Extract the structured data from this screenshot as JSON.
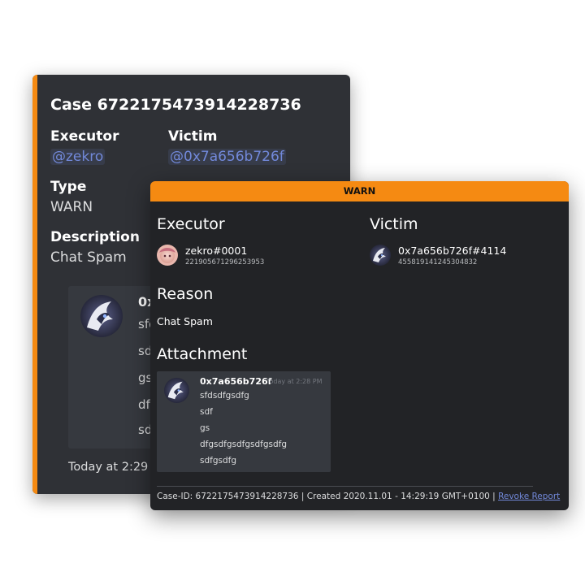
{
  "embed": {
    "title": "Case 6722175473914228736",
    "executor": {
      "name": "Executor",
      "value": "@zekro"
    },
    "victim": {
      "name": "Victim",
      "value": "@0x7a656b726f"
    },
    "type": {
      "name": "Type",
      "value": "WARN"
    },
    "description": {
      "name": "Description",
      "value": "Chat Spam"
    },
    "image": {
      "author": "0x7a",
      "lines": [
        "sfds",
        "sdf",
        "gs",
        "dfgs",
        "sdfg"
      ]
    },
    "footer": "Today at 2:29 PM",
    "accent_color": "#f58a12"
  },
  "report": {
    "banner": "WARN",
    "executor_heading": "Executor",
    "victim_heading": "Victim",
    "executor": {
      "tag": "zekro#0001",
      "id": "221905671296253953"
    },
    "victim": {
      "tag": "0x7a656b726f#4114",
      "id": "455819141245304832"
    },
    "reason_heading": "Reason",
    "reason": "Chat Spam",
    "attachment_heading": "Attachment",
    "attachment": {
      "author": "0x7a656b726f",
      "timestamp": "Today at 2:28 PM",
      "lines": [
        "sfdsdfgsdfg",
        "sdf",
        "gs",
        "dfgsdfgsdfgsdfgsdfg",
        "sdfgsdfg"
      ]
    },
    "footer": {
      "case_id": "Case-ID: 6722175473914228736",
      "separator": "|",
      "created": "Created 2020.11.01 - 14:29:19 GMT+0100",
      "revoke": "Revoke Report"
    },
    "accent_color": "#f58a12",
    "link_color": "#7289da"
  }
}
